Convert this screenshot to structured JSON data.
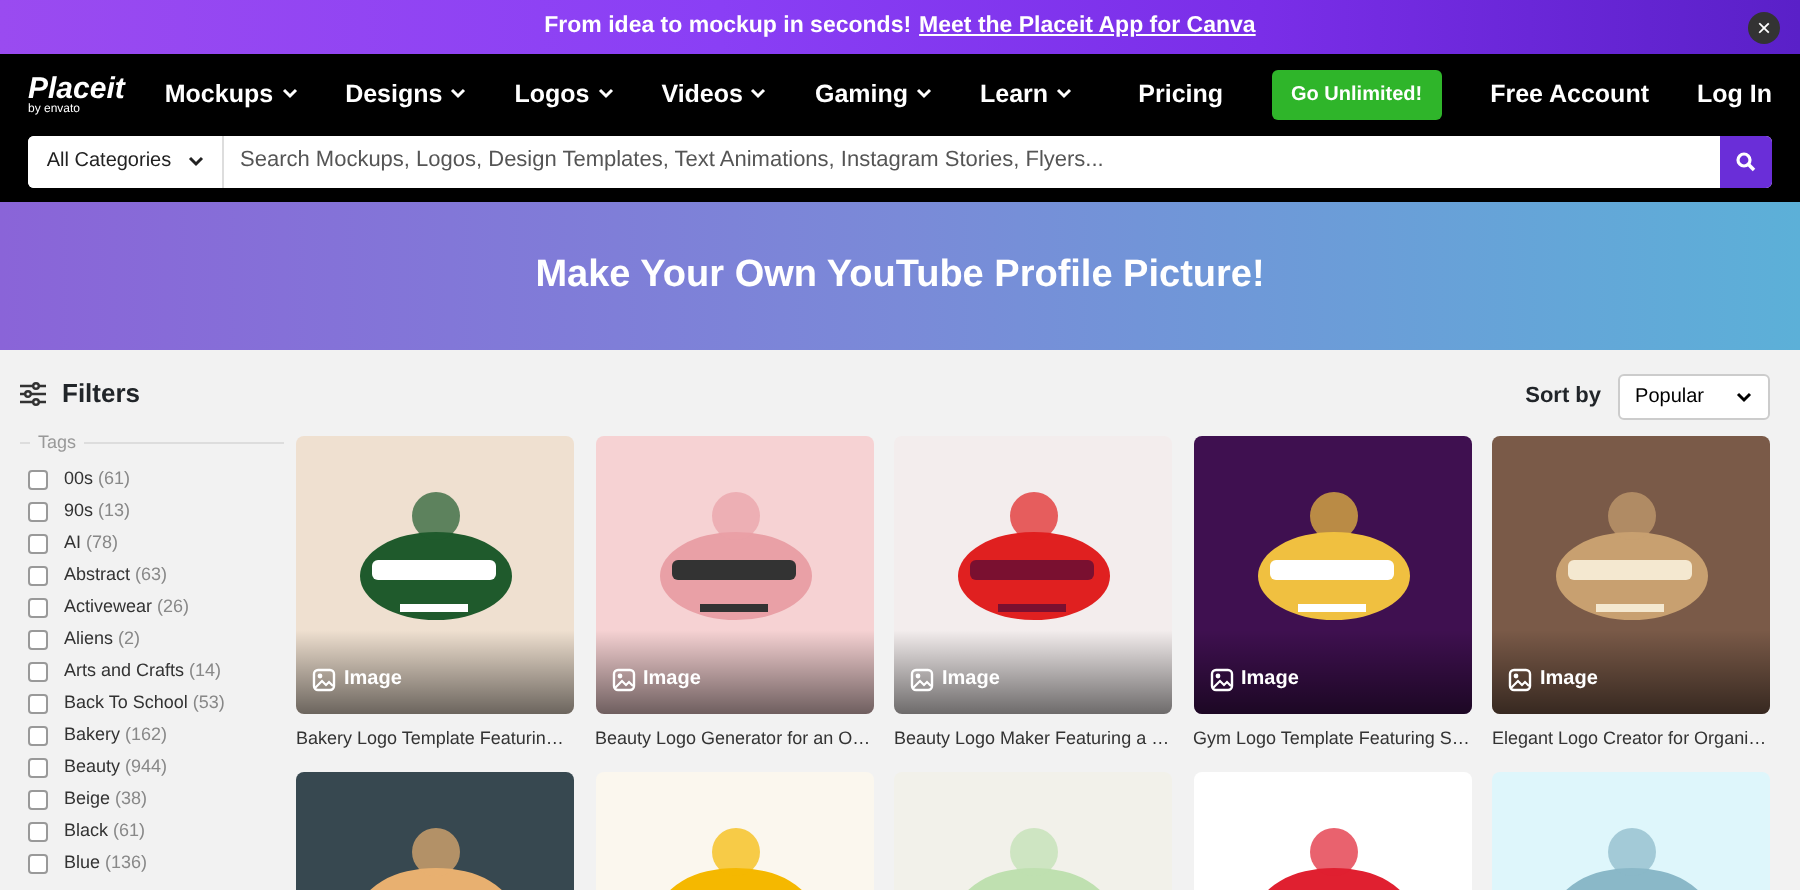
{
  "promo_bar": {
    "text": "From idea to mockup in seconds!",
    "link": "Meet the Placeit App for Canva",
    "close": "×"
  },
  "logo": {
    "name": "Placeit",
    "byline": "by envato"
  },
  "nav": [
    {
      "label": "Mockups",
      "has_menu": true
    },
    {
      "label": "Designs",
      "has_menu": true
    },
    {
      "label": "Logos",
      "has_menu": true
    },
    {
      "label": "Videos",
      "has_menu": true
    },
    {
      "label": "Gaming",
      "has_menu": true
    },
    {
      "label": "Learn",
      "has_menu": true
    }
  ],
  "nav_right": [
    {
      "label": "Pricing",
      "kind": "link"
    },
    {
      "label": "Go Unlimited!",
      "kind": "button"
    },
    {
      "label": "Free Account",
      "kind": "link"
    },
    {
      "label": "Log In",
      "kind": "link"
    }
  ],
  "search": {
    "category": "All Categories",
    "placeholder": "Search Mockups, Logos, Design Templates, Text Animations, Instagram Stories, Flyers..."
  },
  "hero": {
    "title": "Make Your Own YouTube Profile Picture!"
  },
  "filters": {
    "title": "Filters",
    "group": "Tags",
    "tags": [
      {
        "label": "00s",
        "count": "(61)",
        "checked": false
      },
      {
        "label": "90s",
        "count": "(13)",
        "checked": false
      },
      {
        "label": "AI",
        "count": "(78)",
        "checked": false
      },
      {
        "label": "Abstract",
        "count": "(63)",
        "checked": false
      },
      {
        "label": "Activewear",
        "count": "(26)",
        "checked": false
      },
      {
        "label": "Aliens",
        "count": "(2)",
        "checked": false
      },
      {
        "label": "Arts and Crafts",
        "count": "(14)",
        "checked": false
      },
      {
        "label": "Back To School",
        "count": "(53)",
        "checked": false
      },
      {
        "label": "Bakery",
        "count": "(162)",
        "checked": false
      },
      {
        "label": "Beauty",
        "count": "(944)",
        "checked": false
      },
      {
        "label": "Beige",
        "count": "(38)",
        "checked": false
      },
      {
        "label": "Black",
        "count": "(61)",
        "checked": false
      },
      {
        "label": "Blue",
        "count": "(136)",
        "checked": false
      }
    ]
  },
  "sort": {
    "label": "Sort by",
    "value": "Popular"
  },
  "cards": [
    {
      "kind": "picture",
      "badge": "Image",
      "title": "Bakery Logo Template Featurin…"
    },
    {
      "kind": "picture",
      "badge": "Image",
      "title": "Beauty Logo Generator for an O…"
    },
    {
      "kind": "picture",
      "badge": "Image",
      "title": "Beauty Logo Maker Featuring a …"
    },
    {
      "kind": "picture",
      "badge": "Image",
      "title": "Gym Logo Template Featuring S…"
    },
    {
      "kind": "picture",
      "badge": "Image",
      "title": "Elegant Logo Creator for Organi…"
    },
    {
      "kind": "picture"
    },
    {
      "kind": "picture"
    },
    {
      "kind": "picture"
    },
    {
      "kind": "picture"
    },
    {
      "kind": "picture"
    }
  ]
}
